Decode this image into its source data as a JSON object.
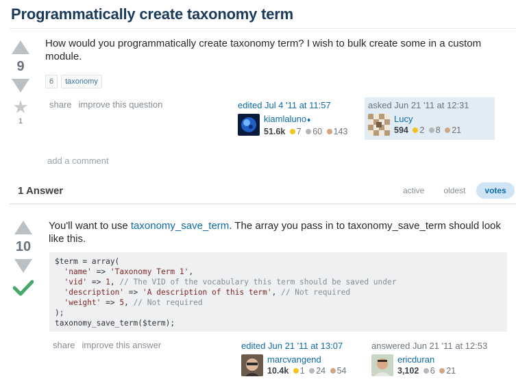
{
  "question": {
    "title": "Programmatically create taxonomy term",
    "votes": "9",
    "favorites": "1",
    "body": "How would you programmatically create taxonomy term? I wish to bulk create some in a custom module.",
    "tags": [
      "6",
      "taxonomy"
    ],
    "menu": {
      "share": "share",
      "improve": "improve this question"
    },
    "editor": {
      "action": "edited Jul 4 '11 at 11:57",
      "name": "kiamlaluno",
      "diamond": "♦",
      "rep": "51.6k",
      "gold": "7",
      "silver": "60",
      "bronze": "143"
    },
    "asker": {
      "action": "asked Jun 21 '11 at 12:31",
      "name": "Lucy",
      "rep": "594",
      "gold": "2",
      "silver": "8",
      "bronze": "21"
    },
    "add_comment": "add a comment"
  },
  "answers": {
    "header": "1 Answer",
    "sort_tabs": [
      "active",
      "oldest",
      "votes"
    ],
    "active_tab": "votes"
  },
  "answer": {
    "votes": "10",
    "accepted": true,
    "body_before": "You'll want to use ",
    "body_link": "taxonomy_save_term",
    "body_after": ". The array you pass in to taxonomy_save_term should look like this.",
    "code": {
      "l1": "$term = array(",
      "l2_key": "'name'",
      "l2_op": " => ",
      "l2_val": "'Taxonomy Term 1'",
      "l2_end": ",",
      "l3_key": "'vid'",
      "l3_op": " => ",
      "l3_val": "1",
      "l3_end": ", ",
      "l3_com": "// The VID of the vocabulary this term should be saved under",
      "l4_key": "'description'",
      "l4_op": " => ",
      "l4_val": "'A description of this term'",
      "l4_end": ", ",
      "l4_com": "// Not required",
      "l5_key": "'weight'",
      "l5_op": " => ",
      "l5_val": "5",
      "l5_end": ", ",
      "l5_com": "// Not required",
      "l6": ");",
      "l7": "taxonomy_save_term($term);"
    },
    "menu": {
      "share": "share",
      "improve": "improve this answer"
    },
    "editor": {
      "action": "edited Jun 21 '11 at 13:07",
      "name": "marcvangend",
      "rep": "10.4k",
      "gold": "1",
      "silver": "24",
      "bronze": "54"
    },
    "answerer": {
      "action": "answered Jun 21 '11 at 12:53",
      "name": "ericduran",
      "rep": "3,102",
      "silver": "6",
      "bronze": "21"
    }
  },
  "colors": {
    "link": "#0c6aa8",
    "vote_arrow": "#bbc0c4",
    "accepted": "#48a868",
    "asker_bg": "#e1ecf4",
    "gold": "#f4c321",
    "silver": "#b4b8bc",
    "bronze": "#d1a684"
  },
  "icons": [
    "upvote-arrow-icon",
    "downvote-arrow-icon",
    "favorite-star-icon",
    "accepted-check-icon",
    "moderator-diamond-icon"
  ]
}
